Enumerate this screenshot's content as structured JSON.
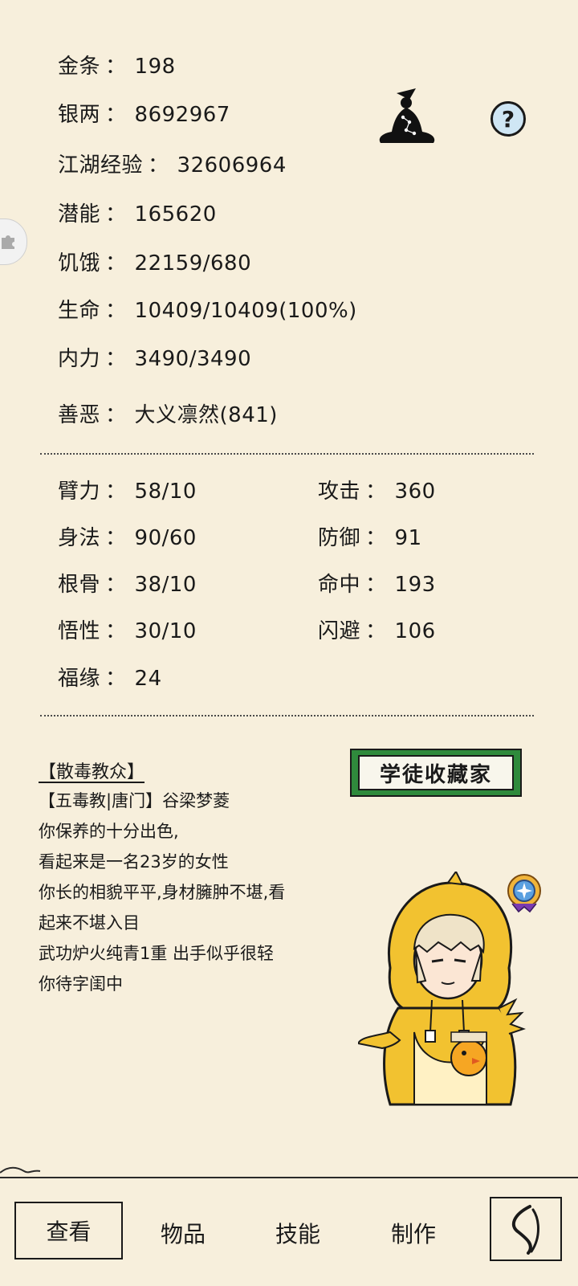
{
  "stats_top": [
    {
      "key": "金条",
      "value": "198"
    },
    {
      "key": "银两",
      "value": "8692967"
    },
    {
      "key": "江湖经验",
      "value": "32606964"
    },
    {
      "key": "潜能",
      "value": "165620"
    },
    {
      "key": "饥饿",
      "value": "22159/680"
    },
    {
      "key": "生命",
      "value": "10409/10409(100%)"
    },
    {
      "key": "内力",
      "value": "3490/3490"
    },
    {
      "key": "善恶",
      "value": "大义凛然(841)"
    }
  ],
  "stats_left": [
    {
      "key": "臂力",
      "value": "58/10"
    },
    {
      "key": "身法",
      "value": "90/60"
    },
    {
      "key": "根骨",
      "value": "38/10"
    },
    {
      "key": "悟性",
      "value": "30/10"
    },
    {
      "key": "福缘",
      "value": "24"
    }
  ],
  "stats_right": [
    {
      "key": "攻击",
      "value": "360"
    },
    {
      "key": "防御",
      "value": "91"
    },
    {
      "key": "命中",
      "value": "193"
    },
    {
      "key": "闪避",
      "value": "106"
    }
  ],
  "separator": "：",
  "help_label": "?",
  "identity": {
    "title": "【散毒教众】",
    "lines": [
      "【五毒教|唐门】谷梁梦菱",
      "你保养的十分出色,",
      "看起来是一名23岁的女性",
      "你长的相貌平平,身材臃肿不堪,看",
      "起来不堪入目",
      "武功炉火纯青1重 出手似乎很轻",
      "你待字闺中"
    ],
    "banner": "学徒收藏家"
  },
  "nav": {
    "view": "查看",
    "items": "物品",
    "skills": "技能",
    "craft": "制作"
  },
  "icons": {
    "meditation": "meditation-silhouette-icon",
    "help": "help-icon",
    "back": "back-icon",
    "badge": "medal-icon",
    "side_tab": "puzzle-icon"
  }
}
